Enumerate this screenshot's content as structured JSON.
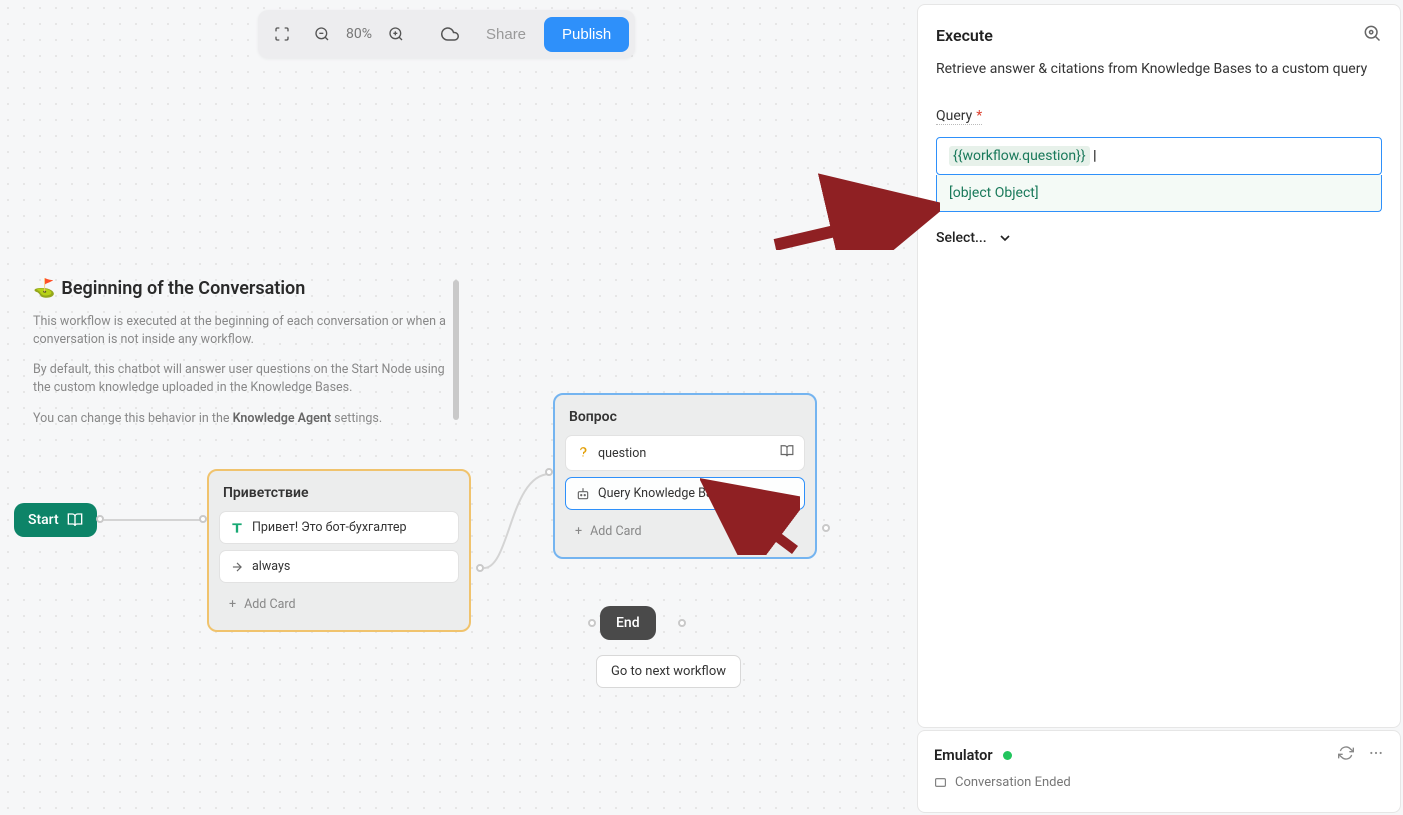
{
  "toolbar": {
    "zoom_level": "80%",
    "share_label": "Share",
    "publish_label": "Publish"
  },
  "info": {
    "emoji": "⛳",
    "title": "Beginning of the Conversation",
    "para1": "This workflow is executed at the beginning of each conversation or when a conversation is not inside any workflow.",
    "para2_pre": "By default, this chatbot will answer user questions on the Start Node using the custom knowledge uploaded in the Knowledge Bases.",
    "para3_pre": "You can change this behavior in the ",
    "para3_bold": "Knowledge Agent",
    "para3_post": " settings."
  },
  "start_node": {
    "label": "Start"
  },
  "greeting_node": {
    "title": "Приветствие",
    "card1": "Привет! Это бот-бухгалтер",
    "card2": "always",
    "add_card": "Add Card"
  },
  "question_node": {
    "title": "Вопрос",
    "card1": "question",
    "card2": "Query Knowledge Bases",
    "add_card": "Add Card"
  },
  "end_node": {
    "label": "End"
  },
  "next_workflow": {
    "label": "Go to next workflow"
  },
  "panel": {
    "title": "Execute",
    "description": "Retrieve answer & citations from Knowledge Bases to a custom query",
    "query_label": "Query",
    "query_value": "{{workflow.question}}",
    "autocomplete_item": "[object Object]",
    "select_label": "Select..."
  },
  "emulator": {
    "title": "Emulator",
    "message": "Conversation Ended"
  }
}
